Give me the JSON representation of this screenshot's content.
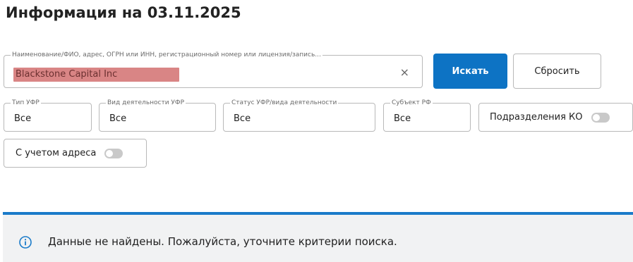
{
  "page": {
    "title": "Информация на 03.11.2025"
  },
  "search": {
    "legend": "Наименование/ФИО, адрес, ОГРН или ИНН, регистрационный номер или лицензия/запись...",
    "value": "Blackstone Capital Inc",
    "clear_icon": "close-icon",
    "clear_glyph": "×",
    "search_label": "Искать",
    "reset_label": "Сбросить"
  },
  "filters": {
    "type": {
      "legend": "Тип УФР",
      "value": "Все"
    },
    "activity": {
      "legend": "Вид деятельности УФР",
      "value": "Все"
    },
    "status": {
      "legend": "Статус УФР/вида деятельности",
      "value": "Все"
    },
    "region": {
      "legend": "Субъект РФ",
      "value": "Все"
    },
    "branches_toggle": {
      "label": "Подразделения КО",
      "on": false
    },
    "address_toggle": {
      "label": "С учетом адреса",
      "on": false
    }
  },
  "alert": {
    "icon": "info-icon",
    "text": "Данные не найдены. Пожалуйста, уточните критерии поиска.",
    "accent_color": "#1a7bc9"
  },
  "colors": {
    "primary": "#0d73c4",
    "redaction": "#d98585"
  }
}
